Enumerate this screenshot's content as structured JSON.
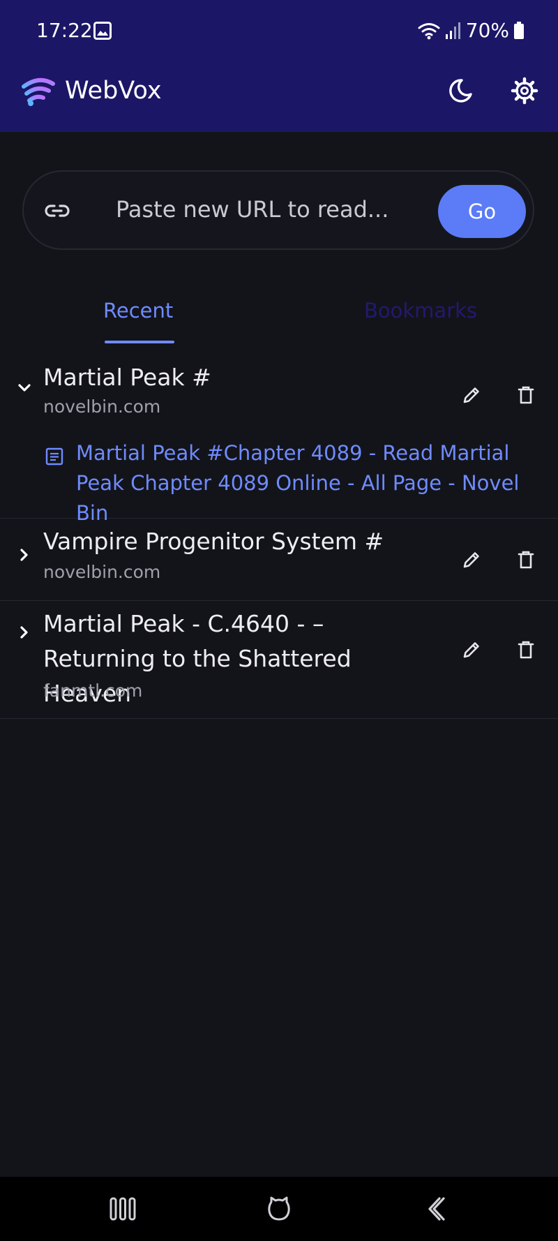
{
  "status_bar": {
    "time": "17:22",
    "battery": "70%",
    "icons": [
      "gallery-icon",
      "wifi-icon",
      "signal-icon",
      "battery-icon"
    ]
  },
  "app_bar": {
    "title": "WebVox",
    "icons": [
      "webvox-logo-icon",
      "moon-icon",
      "gear-icon"
    ]
  },
  "url_bar": {
    "placeholder": "Paste new URL to read...",
    "value": "",
    "go_label": "Go"
  },
  "tabs": [
    {
      "label": "Recent",
      "active": true
    },
    {
      "label": "Bookmarks",
      "active": false
    }
  ],
  "recent_items": [
    {
      "title": "Martial Peak #",
      "domain": "novelbin.com",
      "expanded": true,
      "children": [
        {
          "title": "Martial Peak #Chapter 4089 - Read Martial Peak Chapter 4089 Online - All Page - Novel Bin"
        }
      ]
    },
    {
      "title": "Vampire Progenitor System #",
      "domain": "novelbin.com",
      "expanded": false
    },
    {
      "title": "Martial Peak - C.4640 - – Returning to the Shattered Heaven",
      "domain": "fanmtl.com",
      "expanded": false
    }
  ],
  "colors": {
    "header_bg": "#1c1666",
    "page_bg": "#13141a",
    "accent": "#5b7cf6",
    "link": "#6f8bff",
    "bookmarks_tab": "#211a6e"
  },
  "nav_bar": {
    "icons": [
      "recents-icon",
      "home-icon",
      "back-icon"
    ]
  }
}
